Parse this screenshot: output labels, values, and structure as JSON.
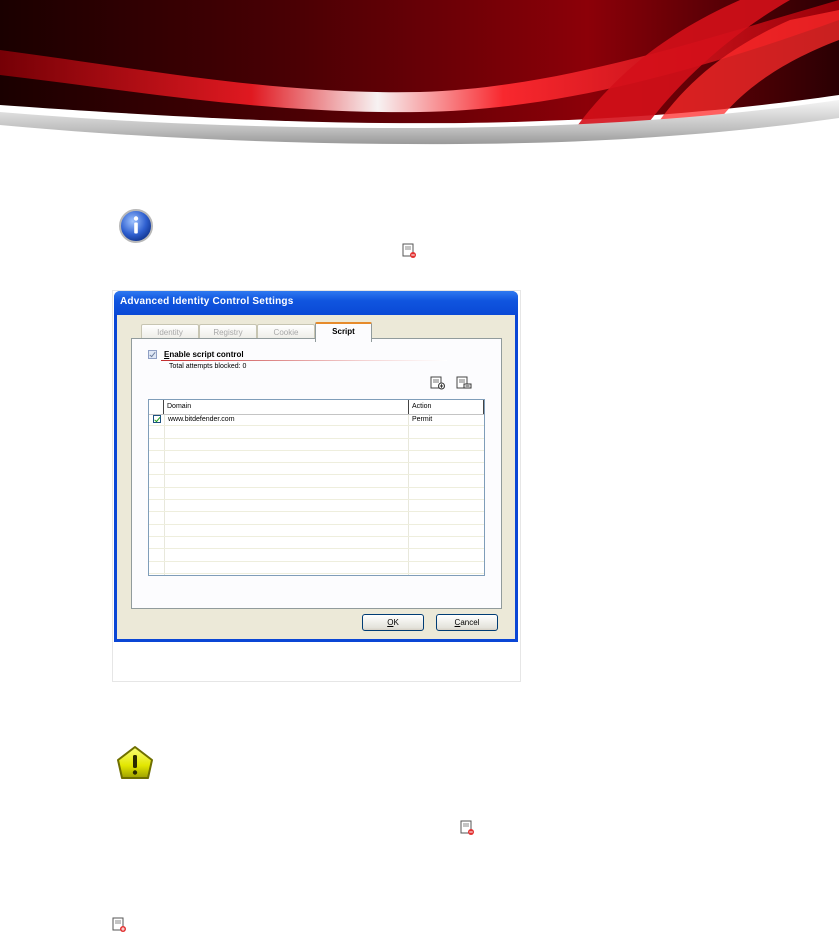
{
  "dialog": {
    "title": "Advanced Identity Control Settings",
    "tabs": [
      {
        "label": "Identity"
      },
      {
        "label": "Registry"
      },
      {
        "label": "Cookie"
      },
      {
        "label": "Script",
        "selected": true
      }
    ],
    "enable_label": "Enable script control",
    "enable_checked": true,
    "attempts_text": "Total attempts blocked: 0",
    "toolbar": {
      "add_icon": "add-rule-icon",
      "remove_icon": "remove-rule-icon"
    },
    "grid": {
      "columns": [
        "Domain",
        "Action"
      ],
      "rows": [
        {
          "checked": true,
          "domain": "www.bitdefender.com",
          "action": "Permit"
        }
      ]
    },
    "ok_label": "OK",
    "cancel_label": "Cancel"
  },
  "colors": {
    "titlebar": "#0a49d6",
    "client": "#ece9d8",
    "banner_red": "#c40a14"
  },
  "icons": {
    "info": "info-icon",
    "warning": "warning-icon",
    "inline_doc_1": "remove-rule-icon",
    "inline_doc_2": "remove-rule-icon",
    "inline_doc_3": "add-rule-icon"
  }
}
